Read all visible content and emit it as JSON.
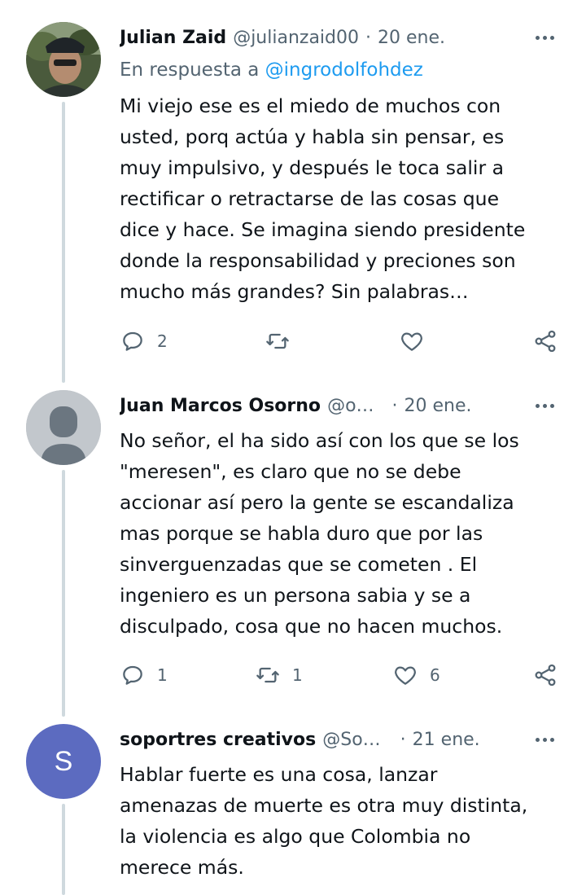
{
  "tweets": [
    {
      "author_name": "Julian Zaid",
      "author_handle": "@julianzaid00",
      "date": "20 ene.",
      "reply_prefix": "En respuesta a ",
      "reply_mention": "@ingrodolfohdez",
      "text": "Mi viejo ese es el miedo de muchos con\nusted, porq actúa y habla sin pensar, es\nmuy impulsivo, y después le toca salir a\nrectificar o retractarse de las cosas que\ndice y hace. Se imagina siendo presidente\ndonde la responsabilidad y preciones son\nmucho más grandes? Sin palabras…",
      "replies": "2",
      "retweets": "",
      "likes": ""
    },
    {
      "author_name": "Juan Marcos Osorno",
      "author_handle": "@o…",
      "date": "20 ene.",
      "text": "No señor, el ha sido así con los que se los\n\"meresen\", es claro que no se debe\naccionar así pero la gente se escandaliza\nmas porque se habla duro que por las\nsinverguenzadas que se cometen . El\ningeniero es un persona sabia y se a\ndisculpado, cosa que no hacen muchos.",
      "replies": "1",
      "retweets": "1",
      "likes": "6"
    },
    {
      "author_name": "soportres creativos",
      "author_handle": "@So…",
      "date": "21 ene.",
      "avatar_letter": "S",
      "text": "Hablar fuerte es una cosa, lanzar\namenazas de muerte es otra muy distinta,\nla violencia es algo que Colombia no\nmerece más."
    }
  ],
  "colors": {
    "text": "#0f1419",
    "secondary": "#536471",
    "link": "#1d9bf0",
    "thread_line": "#cfd9de",
    "avatar_default_bg": "#c2c7cc",
    "avatar_letter_bg": "#5c6bc0"
  }
}
